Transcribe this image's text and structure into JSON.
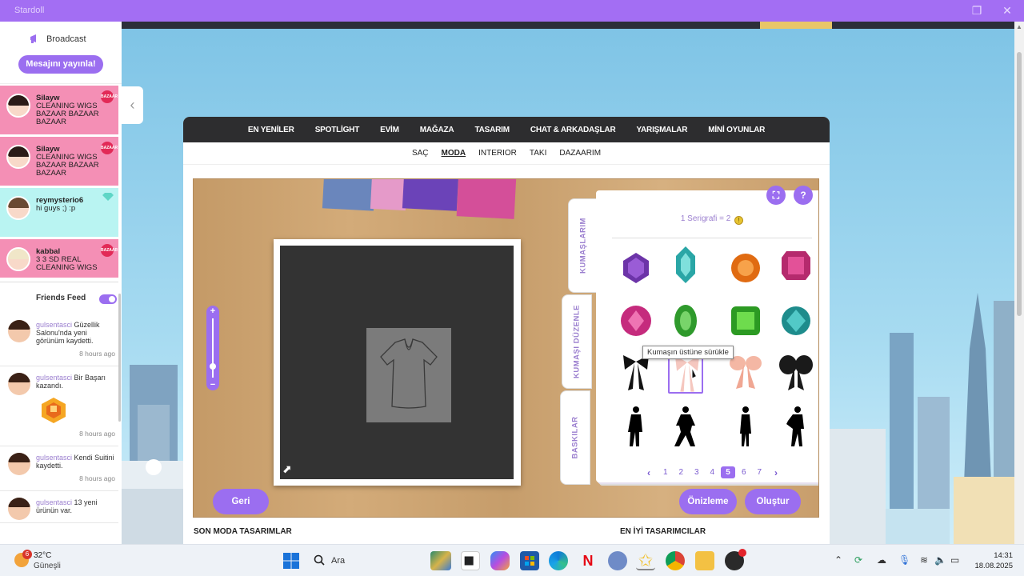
{
  "window": {
    "title": "Stardoll"
  },
  "sidebar": {
    "broadcast_label": "Broadcast",
    "publish_button": "Mesajını yayınla!",
    "broadcasts": [
      {
        "user": "Silayw",
        "message": "CLEANING WIGS BAZAAR BAZAAR BAZAAR",
        "color": "#f48fb5",
        "badge": "BAZAAR"
      },
      {
        "user": "Silayw",
        "message": "CLEANING WIGS BAZAAR BAZAAR BAZAAR",
        "color": "#f48fb5",
        "badge": "BAZAAR"
      },
      {
        "user": "reymysterio6",
        "message": "hi guys ;) :p",
        "color": "#b9f4f2"
      },
      {
        "user": "kabbal",
        "message": "3 3 SD REAL CLEANING WIGS",
        "color": "#f48fb5",
        "badge": "BAZAAR"
      }
    ],
    "friends_feed_label": "Friends Feed",
    "feed": [
      {
        "user": "gulsentasci",
        "text": "Güzellik Salonu'nda yeni görünüm kaydetti.",
        "time": "8 hours ago"
      },
      {
        "user": "gulsentasci",
        "text": "Bir Başarı kazandı.",
        "time": "8 hours ago",
        "has_trophy": true
      },
      {
        "user": "gulsentasci",
        "text": "Kendi Suitini kaydetti.",
        "time": "8 hours ago"
      },
      {
        "user": "gulsentasci",
        "text": "13 yeni ürünün var.",
        "time": ""
      }
    ]
  },
  "nav": {
    "main": [
      "EN YENİLER",
      "SPOTLİGHT",
      "EVİM",
      "MAĞAZA",
      "TASARIM",
      "CHAT & ARKADAŞLAR",
      "YARIŞMALAR",
      "MİNİ OYUNLAR"
    ],
    "sub": [
      {
        "label": "SAÇ",
        "active": false
      },
      {
        "label": "MODA",
        "active": true
      },
      {
        "label": "INTERIOR",
        "active": false
      },
      {
        "label": "TAKI",
        "active": false
      },
      {
        "label": "DAZAARIM",
        "active": false
      }
    ]
  },
  "designer": {
    "tabs": [
      "KUMAŞLARIM",
      "KUMAŞI DÜZENLE",
      "BASKILAR"
    ],
    "serigrafi_text": "1 Serigrafi  = 2",
    "tooltip": "Kumaşın üstüne sürükle",
    "pages": [
      "1",
      "2",
      "3",
      "4",
      "5",
      "6",
      "7"
    ],
    "current_page": "5",
    "back_button": "Geri",
    "preview_button": "Önizleme",
    "create_button": "Oluştur",
    "help_label": "?",
    "expand_label": "⛶"
  },
  "bottom": {
    "left_heading": "SON MODA TASARIMLAR",
    "right_heading": "EN İYİ TASARIMCILAR"
  },
  "taskbar": {
    "temperature": "32°C",
    "condition": "Güneşli",
    "weather_badge": "6",
    "search_label": "Ara",
    "time": "14:31",
    "date": "18.08.2025"
  },
  "colors": {
    "accent": "#9b6ef0",
    "titlebar": "#a36ef3",
    "nav": "#2d2d2f",
    "broadcast_pink": "#f48fb5",
    "broadcast_cyan": "#b9f4f2"
  }
}
